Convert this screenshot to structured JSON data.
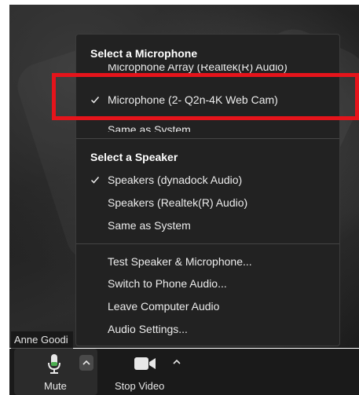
{
  "participant": {
    "name": "Anne Goodi"
  },
  "toolbar": {
    "mute_label": "Mute",
    "stop_video_label": "Stop Video",
    "mute_options_icon": "chevron-up-icon",
    "video_options_icon": "chevron-up-icon"
  },
  "menu": {
    "microphone_header": "Select a Microphone",
    "microphones": [
      {
        "label": "Microphone Array (Realtek(R) Audio)",
        "selected": false
      },
      {
        "label": "Microphone (2- Q2n-4K Web Cam)",
        "selected": true
      },
      {
        "label": "Same as System",
        "selected": false
      }
    ],
    "speaker_header": "Select a Speaker",
    "speakers": [
      {
        "label": "Speakers (dynadock Audio)",
        "selected": true
      },
      {
        "label": "Speakers (Realtek(R) Audio)",
        "selected": false
      },
      {
        "label": "Same as System",
        "selected": false
      }
    ],
    "actions": [
      {
        "label": "Test Speaker & Microphone..."
      },
      {
        "label": "Switch to Phone Audio..."
      },
      {
        "label": "Leave Computer Audio"
      },
      {
        "label": "Audio Settings..."
      }
    ]
  },
  "colors": {
    "highlight": "#e5141b",
    "menu_bg": "#222222",
    "toolbar_bg": "#1a1a1a"
  }
}
